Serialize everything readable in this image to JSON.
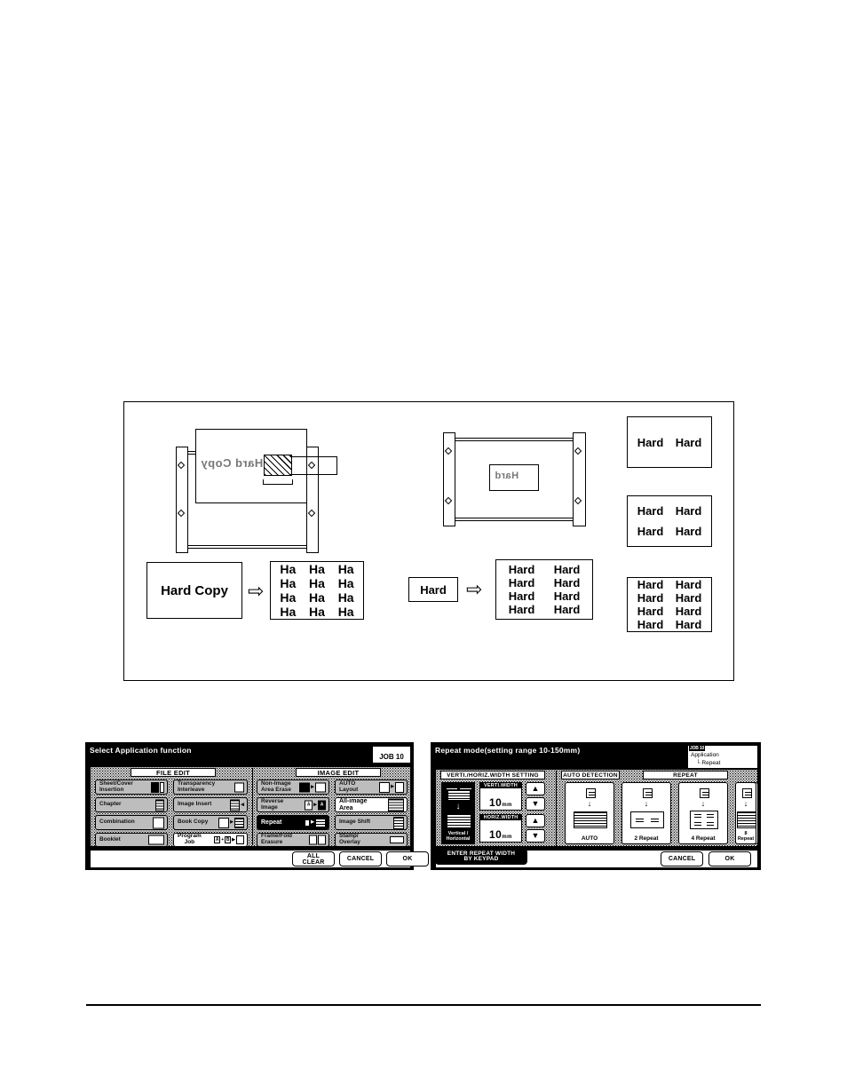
{
  "diagram": {
    "original_label": "Hard Copy",
    "original_short": "Hard",
    "repeat_cell_short": "Ha",
    "repeat_cell_long": "Hard",
    "ghost_text_left": "Hard Copy",
    "ghost_text_right": "Hard",
    "arrow_glyph": "⇨",
    "left_result_rows": 4,
    "left_result_cols": 3,
    "mid_result_rows": 4,
    "mid_result_cols": 2,
    "right_results": [
      {
        "name": "2-repeat-sample",
        "rows": 1,
        "cols": 2
      },
      {
        "name": "4-repeat-sample",
        "rows": 2,
        "cols": 2
      },
      {
        "name": "8-repeat-sample",
        "rows": 4,
        "cols": 2
      }
    ]
  },
  "panel_left": {
    "title": "Select Application function",
    "job_badge": "JOB 10",
    "col_headers": {
      "file_edit": "FILE EDIT",
      "image_edit": "IMAGE EDIT"
    },
    "file_edit_left": [
      {
        "label": "Sheet/Cover\nInsertion",
        "icon": "sheet-cover-icon",
        "selected": false
      },
      {
        "label": "Chapter",
        "icon": "chapter-icon",
        "selected": false
      },
      {
        "label": "Combination",
        "icon": "combination-icon",
        "selected": false
      },
      {
        "label": "Booklet",
        "icon": "booklet-icon",
        "selected": false
      }
    ],
    "file_edit_right": [
      {
        "label": "Transparency\nInterleave",
        "icon": "transparency-icon",
        "selected": false
      },
      {
        "label": "Image Insert",
        "icon": "image-insert-icon",
        "selected": false
      },
      {
        "label": "Book Copy",
        "icon": "book-copy-icon",
        "selected": false
      },
      {
        "label": "Program\nJob",
        "icon": "program-job-icon",
        "selected": false,
        "white": true
      }
    ],
    "image_edit_left": [
      {
        "label": "Non-Image\nArea Erase",
        "icon": "non-image-area-erase-icon",
        "selected": false
      },
      {
        "label": "Reverse\nImage",
        "icon": "reverse-image-icon",
        "selected": false
      },
      {
        "label": "Repeat",
        "icon": "repeat-icon",
        "selected": true
      },
      {
        "label": "Frame/Fold\nErasure",
        "icon": "frame-fold-erasure-icon",
        "selected": false
      }
    ],
    "image_edit_right": [
      {
        "label": "AUTO\nLayout",
        "icon": "auto-layout-icon",
        "selected": false
      },
      {
        "label": "All-image\nArea",
        "icon": "all-image-area-icon",
        "selected": false,
        "white": true
      },
      {
        "label": "Image Shift",
        "icon": "image-shift-icon",
        "selected": false
      },
      {
        "label": "Stamp/\nOverlay",
        "icon": "stamp-overlay-icon",
        "selected": false
      }
    ],
    "footer": {
      "all_clear": "ALL\nCLEAR",
      "cancel": "CANCEL",
      "ok": "OK"
    }
  },
  "panel_right": {
    "title": "Repeat mode(setting range 10-150mm)",
    "job_badge": "JOB 10",
    "job_tag_line1": "Application",
    "job_tag_line2": "└ Repeat",
    "section_headers": {
      "width_setting": "VERTI./HORIZ.WIDTH SETTING",
      "auto_detection": "AUTO DETECTION",
      "repeat": "REPEAT"
    },
    "orientation_tile": {
      "label": "Vertical /\nHorizontal",
      "down_arrow": "↓"
    },
    "fields": [
      {
        "caption": "VERTI.WIDTH",
        "value": "10",
        "unit": "mm",
        "up": "▲",
        "down": "▼"
      },
      {
        "caption": "HORIZ.WIDTH",
        "value": "10",
        "unit": "mm",
        "up": "▲",
        "down": "▼"
      }
    ],
    "repeat_cards": [
      {
        "label": "AUTO",
        "group": "auto-detection",
        "rows": 3,
        "cols": 4
      },
      {
        "label": "2 Repeat",
        "group": "repeat",
        "rows": 1,
        "cols": 2
      },
      {
        "label": "4 Repeat",
        "group": "repeat",
        "rows": 2,
        "cols": 2
      },
      {
        "label": "8 Repeat",
        "group": "repeat",
        "rows": 2,
        "cols": 4
      }
    ],
    "card_down_arrow": "↓",
    "footer": {
      "keypad": "ENTER REPEAT WIDTH\nBY KEYPAD",
      "cancel": "CANCEL",
      "ok": "OK"
    }
  },
  "colors": {
    "lcd_background": "#000000",
    "panel_fill": "#cfcfcf",
    "button_fill": "#bdbdbd",
    "selected_fill": "#000000",
    "white": "#ffffff"
  }
}
